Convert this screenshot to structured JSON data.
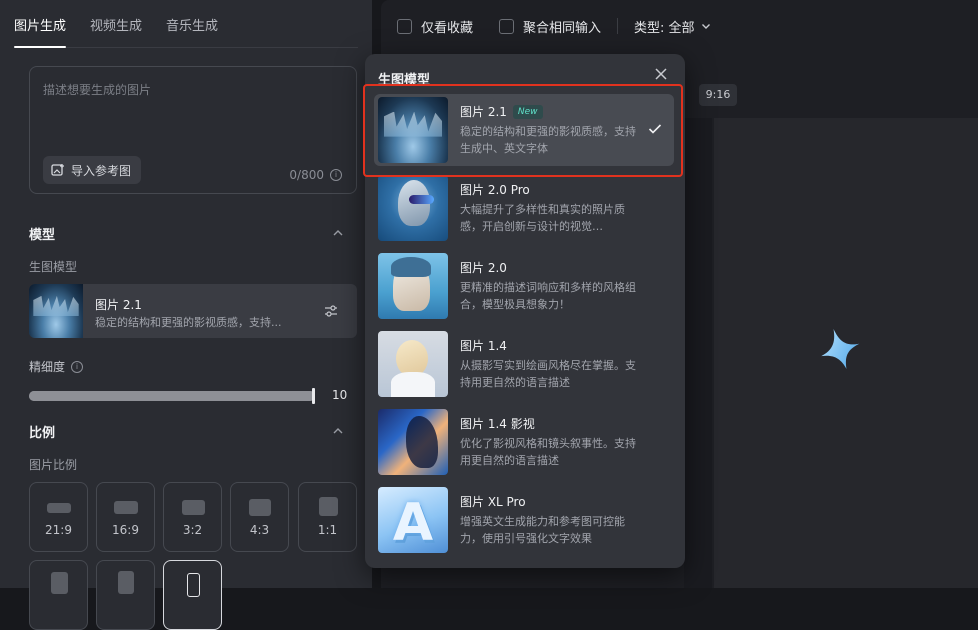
{
  "tabs": [
    "图片生成",
    "视频生成",
    "音乐生成"
  ],
  "prompt": {
    "placeholder": "描述想要生成的图片",
    "ref_button": "导入参考图",
    "counter": "0/800"
  },
  "model_section": {
    "title": "模型",
    "sub_label": "生图模型",
    "current_name": "图片 2.1",
    "current_desc": "稳定的结构和更强的影视质感，支持..."
  },
  "detail": {
    "label": "精细度",
    "value": "10",
    "level_fraction": 1.0
  },
  "ratio_section": {
    "title": "比例",
    "sub_label": "图片比例",
    "ratios": [
      "21:9",
      "16:9",
      "3:2",
      "4:3",
      "1:1"
    ]
  },
  "topbar": {
    "fav_only": "仅看收藏",
    "merge_same": "聚合相同输入",
    "type_label": "类型: 全部"
  },
  "canvas": {
    "ratio_chip": "9:16"
  },
  "modal": {
    "title": "生图模型",
    "items": [
      {
        "name": "图片 2.1",
        "badge": "New",
        "desc": "稳定的结构和更强的影视质感，支持生成中、英文字体",
        "selected": true
      },
      {
        "name": "图片 2.0 Pro",
        "desc": "大幅提升了多样性和真实的照片质感，开启创新与设计的视觉…"
      },
      {
        "name": "图片 2.0",
        "desc": "更精准的描述词响应和多样的风格组合，模型极具想象力！"
      },
      {
        "name": "图片 1.4",
        "desc": "从摄影写实到绘画风格尽在掌握。支持用更自然的语言描述"
      },
      {
        "name": "图片 1.4 影视",
        "desc": "优化了影视风格和镜头叙事性。支持用更自然的语言描述"
      },
      {
        "name": "图片 XL Pro",
        "desc": "增强英文生成能力和参考图可控能力，使用引号强化文字效果"
      }
    ]
  },
  "colors": {
    "accent_highlight": "#e2321e",
    "new_badge": "#5fe0c8"
  },
  "icons": [
    "image-plus-icon",
    "info-icon",
    "chevron-up-icon",
    "adjust-sliders-icon",
    "chevron-down-icon",
    "close-icon",
    "check-icon",
    "sparkle-star-icon"
  ]
}
